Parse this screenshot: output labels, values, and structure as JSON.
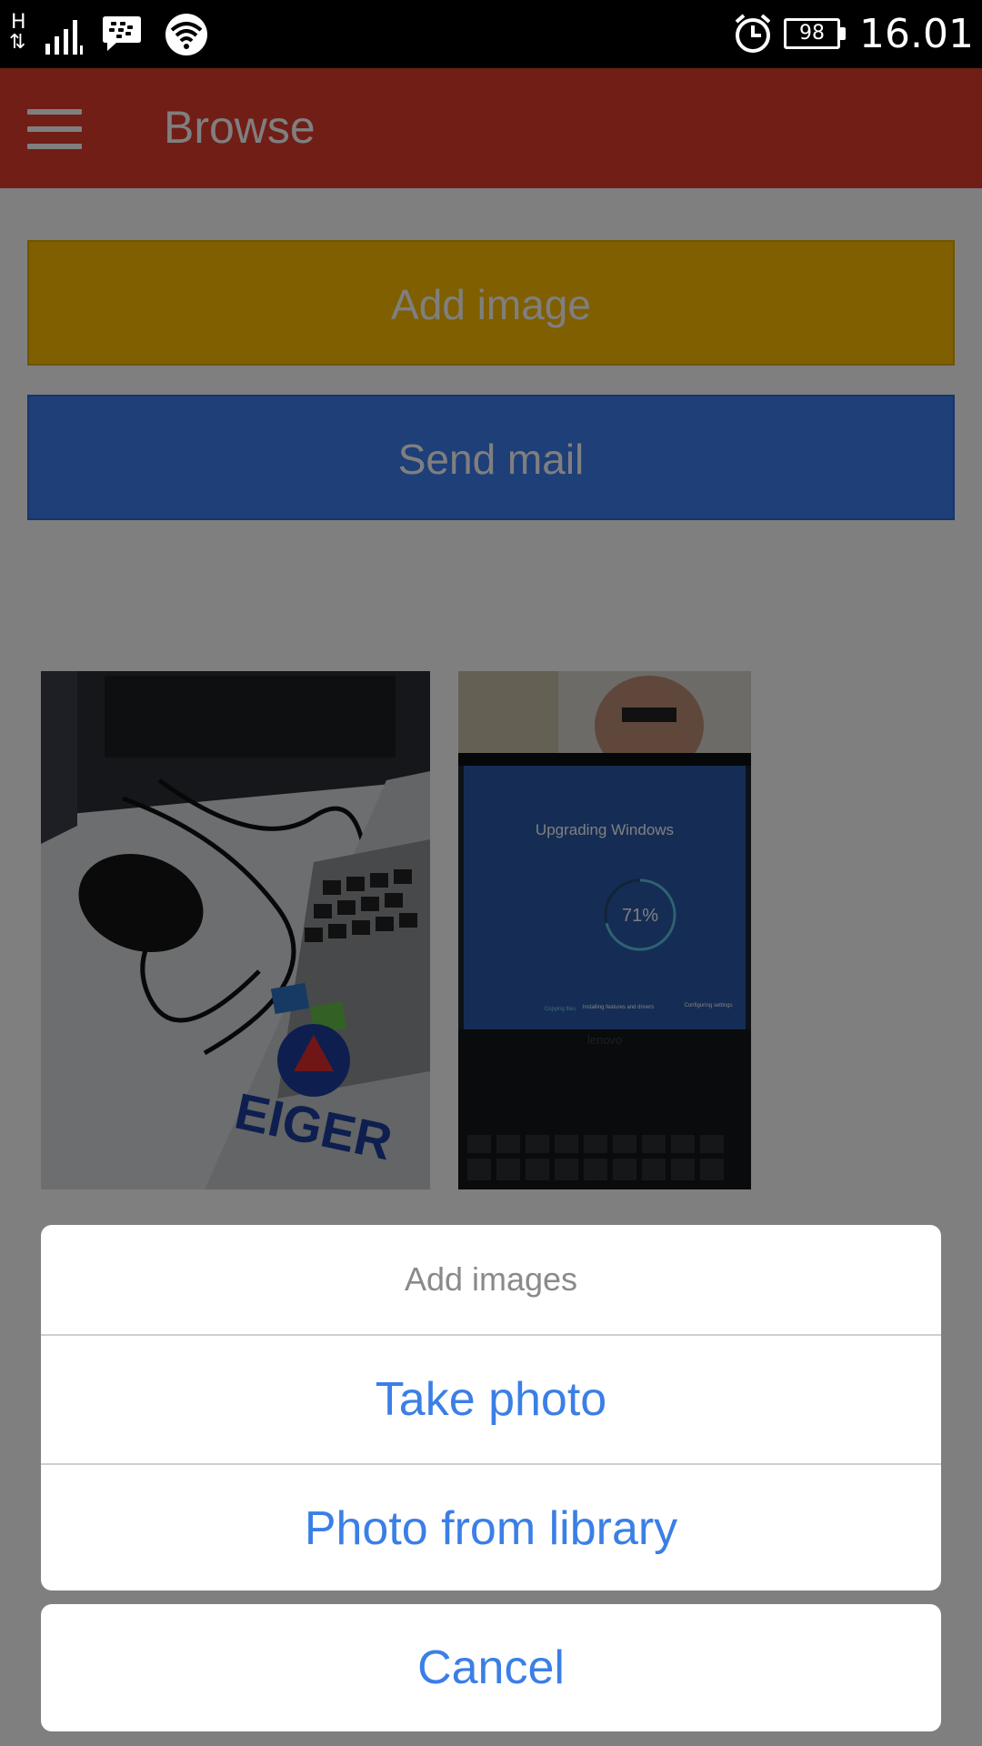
{
  "status_bar": {
    "network_type": "H",
    "network_arrows": "⇅",
    "battery_percent": "98",
    "time": "16.01",
    "icons": [
      "network-h-icon",
      "signal-bars-icon",
      "blackberry-messenger-icon",
      "wifi-icon",
      "alarm-icon",
      "battery-icon"
    ]
  },
  "app_bar": {
    "title": "Browse",
    "menu_icon": "hamburger-menu-icon",
    "color": "#e33d2f"
  },
  "buttons": {
    "add_image": {
      "label": "Add image",
      "color": "#ffbf00"
    },
    "send_mail": {
      "label": "Send mail",
      "color": "#3c7ef0"
    }
  },
  "thumbnails": {
    "photo_2": {
      "screen_title": "Upgrading Windows",
      "progress_text": "71%",
      "progress": 0.71,
      "step_labels": [
        "Copying files",
        "Installing features and drivers",
        "Configuring settings"
      ],
      "brand_text": "lenovo"
    },
    "photo_1": {
      "sticker_text": "EIGER"
    }
  },
  "action_sheet": {
    "title": "Add images",
    "options": [
      "Take photo",
      "Photo from library"
    ],
    "cancel": "Cancel",
    "option_color": "#3b7fe6"
  }
}
